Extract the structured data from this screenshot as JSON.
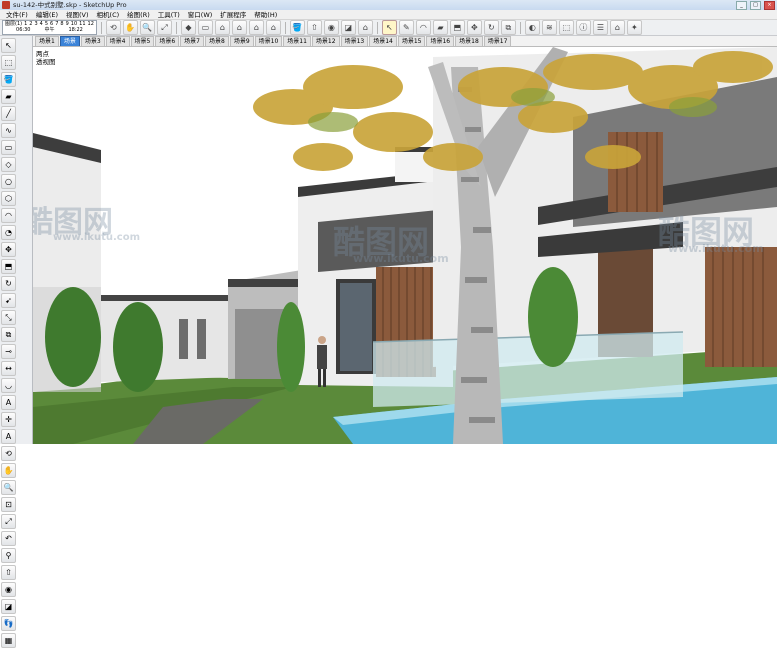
{
  "window": {
    "title": "su-142-中式别墅.skp - SketchUp Pro",
    "buttons": [
      "_",
      "□",
      "×"
    ]
  },
  "menu": [
    "文件(F)",
    "编辑(E)",
    "视图(V)",
    "相机(C)",
    "绘图(R)",
    "工具(T)",
    "窗口(W)",
    "扩展程序",
    "帮助(H)"
  ],
  "layer_selector": {
    "labels": [
      "图层(1)",
      "1",
      "2",
      "3",
      "4",
      "5",
      "6",
      "7",
      "8",
      "9",
      "10",
      "11",
      "12"
    ],
    "time_start": "06:30",
    "time_noon": "中午",
    "time_end": "18:22"
  },
  "scenes": {
    "tabs": [
      "场景1",
      "场景",
      "场景3",
      "场景4",
      "场景5",
      "场景6",
      "场景7",
      "场景8",
      "场景9",
      "场景10",
      "场景11",
      "场景12",
      "场景13",
      "场景14",
      "场景15",
      "场景16",
      "场景18",
      "场景17"
    ],
    "active_index": 1
  },
  "viewport": {
    "view_name": "两点",
    "view_type": "透视图"
  },
  "watermark": {
    "brand": "酷图网",
    "url": "www.ikutu.com"
  },
  "icons": {
    "toolbar": [
      "orbit-icon",
      "pan-icon",
      "zoom-icon",
      "zoom-extents-icon",
      "cube-iso-icon",
      "top-view-icon",
      "front-view-icon",
      "right-view-icon",
      "back-view-icon",
      "left-view-icon",
      "home-icon",
      "paint-icon",
      "walk-icon",
      "look-icon",
      "section-icon",
      "select-icon",
      "pencil-icon",
      "arc-icon",
      "eraser-icon",
      "push-pull-icon",
      "move-icon",
      "rotate-icon",
      "offset-icon",
      "shadow-icon",
      "fog-icon",
      "component-icon",
      "model-info-icon",
      "layers-icon",
      "warehouse-icon",
      "extension-icon"
    ],
    "left": [
      "select-icon",
      "component-icon",
      "paint-icon",
      "eraser-icon",
      "line-icon",
      "freehand-icon",
      "rectangle-icon",
      "rotated-rect-icon",
      "circle-icon",
      "polygon-icon",
      "arc-icon",
      "pie-icon",
      "move-icon",
      "push-pull-icon",
      "rotate-icon",
      "follow-me-icon",
      "scale-icon",
      "offset-icon",
      "tape-icon",
      "dimension-icon",
      "protractor-icon",
      "text-icon",
      "axes-icon",
      "3d-text-icon",
      "orbit-icon",
      "pan-icon",
      "zoom-icon",
      "zoom-window-icon",
      "zoom-extents-icon",
      "previous-icon",
      "position-camera-icon",
      "walk-icon",
      "look-around-icon",
      "section-plane-icon",
      "footprint-icon",
      "sandbox-icon"
    ]
  },
  "colors": {
    "sky": "#ffffff",
    "grass": "#5b8a3a",
    "water": "#4fb4d8",
    "wall": "#ededed",
    "dark_trim": "#404040",
    "wood": "#8b5a3c",
    "leaves": "#c9a43a",
    "active_tab": "#3b83d8"
  }
}
